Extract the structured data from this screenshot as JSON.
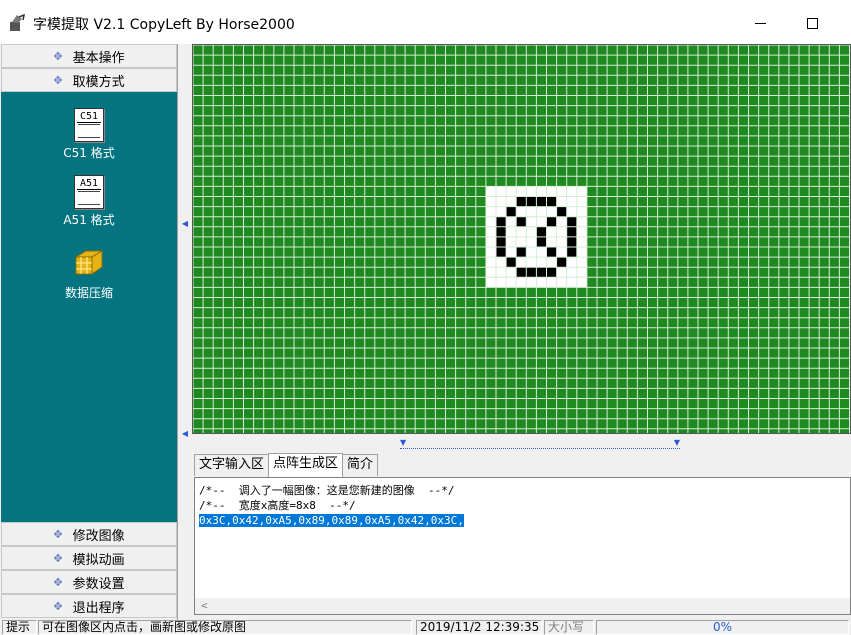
{
  "window": {
    "title": "字模提取 V2.1  CopyLeft By Horse2000"
  },
  "sidebar": {
    "top_items": [
      "基本操作",
      "取模方式"
    ],
    "tools": [
      {
        "icon": "c51-doc-icon",
        "icon_text": "C51",
        "label": "C51 格式"
      },
      {
        "icon": "a51-doc-icon",
        "icon_text": "A51",
        "label": "A51 格式"
      },
      {
        "icon": "compress-cube-icon",
        "label": "数据压缩"
      }
    ],
    "bottom_items": [
      "修改图像",
      "模拟动画",
      "参数设置",
      "退出程序"
    ]
  },
  "canvas": {
    "grid_color": "#1f8a1f",
    "glyph": [
      "0x3C",
      "0x42",
      "0xA5",
      "0x89",
      "0x89",
      "0xA5",
      "0x42",
      "0x3C"
    ]
  },
  "tabs": [
    "文字输入区",
    "点阵生成区",
    "简介"
  ],
  "active_tab": 1,
  "output": {
    "lines": [
      "/*--  调入了一幅图像：这是您新建的图像  --*/",
      "/*--  宽度x高度=8x8  --*/",
      "0x3C,0x42,0xA5,0x89,0x89,0xA5,0x42,0x3C,"
    ]
  },
  "status": {
    "label": "提示",
    "message": "可在图像区内点击，画新图或修改原图",
    "datetime": "2019/11/2 12:39:35",
    "mode": "大小写",
    "progress": "0%"
  }
}
